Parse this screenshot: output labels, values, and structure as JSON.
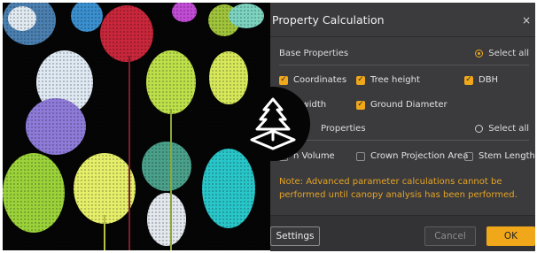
{
  "dialog": {
    "title": "Property Calculation",
    "close_glyph": "×",
    "base": {
      "title": "Base Properties",
      "select_all": "Select all",
      "select_all_checked": true,
      "items": [
        {
          "label": "Coordinates",
          "checked": true
        },
        {
          "label": "Tree height",
          "checked": true
        },
        {
          "label": "DBH",
          "checked": true
        },
        {
          "label": "n width",
          "checked": true
        },
        {
          "label": "Ground Diameter",
          "checked": true
        }
      ]
    },
    "advanced": {
      "title": "Properties",
      "select_all": "Select all",
      "select_all_checked": false,
      "items": [
        {
          "label": "n Volume",
          "checked": false
        },
        {
          "label": "Crown Projection Area",
          "checked": false
        },
        {
          "label": "Stem Length",
          "checked": false
        }
      ]
    },
    "note": "Note: Advanced parameter calculations cannot be performed until canopy analysis has been performed.",
    "buttons": {
      "settings": "Settings",
      "cancel": "Cancel",
      "ok": "OK"
    }
  },
  "viewport": {
    "icon": "tree-on-plane-icon"
  },
  "colors": {
    "accent": "#f0a81a",
    "note_text": "#e5a324",
    "dialog_bg": "#3b3b3d",
    "viewport_bg": "#050505"
  }
}
